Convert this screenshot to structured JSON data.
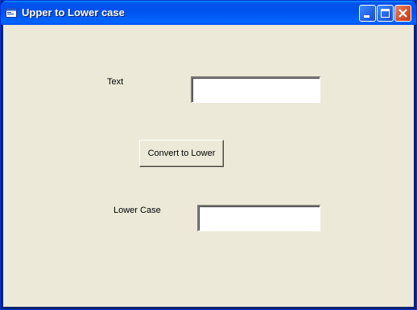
{
  "window": {
    "title": "Upper to Lower case",
    "icon": "form-icon",
    "controls": [
      "minimize-icon",
      "maximize-icon",
      "close-icon"
    ]
  },
  "form": {
    "text_label": "Text",
    "text_value": "",
    "convert_button": "Convert to Lower",
    "lower_label": "Lower Case",
    "lower_value": ""
  },
  "colors": {
    "titlebar": "#0054e3",
    "client_background": "#ece9d8",
    "close_button": "#d5532f"
  }
}
